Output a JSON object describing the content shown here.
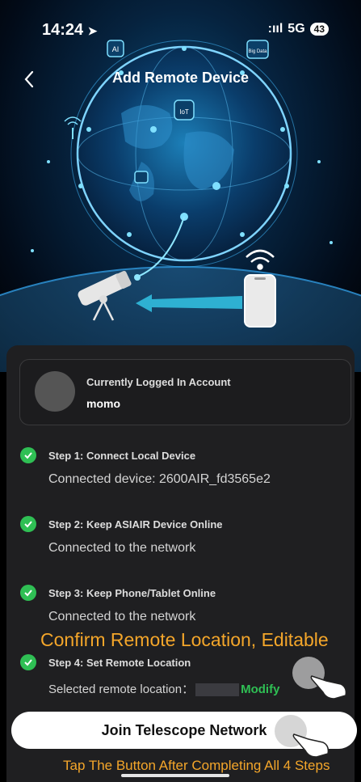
{
  "status_bar": {
    "time": "14:24",
    "signal": ":ııl",
    "network": "5G",
    "battery": "43"
  },
  "nav": {
    "title": "Add Remote Device"
  },
  "hero": {
    "labels": {
      "ai": "AI",
      "iot": "IoT",
      "big_data": "Big Data"
    }
  },
  "account": {
    "label": "Currently Logged In Account",
    "username": "momo"
  },
  "steps": [
    {
      "title": "Step 1: Connect Local Device",
      "detail": "Connected device: 2600AIR_fd3565e2"
    },
    {
      "title": "Step 2: Keep ASIAIR Device Online",
      "detail": "Connected to the network"
    },
    {
      "title": "Step 3: Keep Phone/Tablet Online",
      "detail": "Connected to the network"
    },
    {
      "title": "Step 4: Set Remote Location",
      "detail_prefix": "Selected remote location：",
      "modify_label": "Modify"
    }
  ],
  "annotations": {
    "confirm": "Confirm Remote Location, Editable",
    "tap": "Tap The Button After Completing All 4 Steps"
  },
  "join_button": {
    "label": "Join Telescope Network"
  },
  "colors": {
    "accent_green": "#2fbf54",
    "annotation_orange": "#f4a62a",
    "card_bg": "#1f1f21"
  }
}
